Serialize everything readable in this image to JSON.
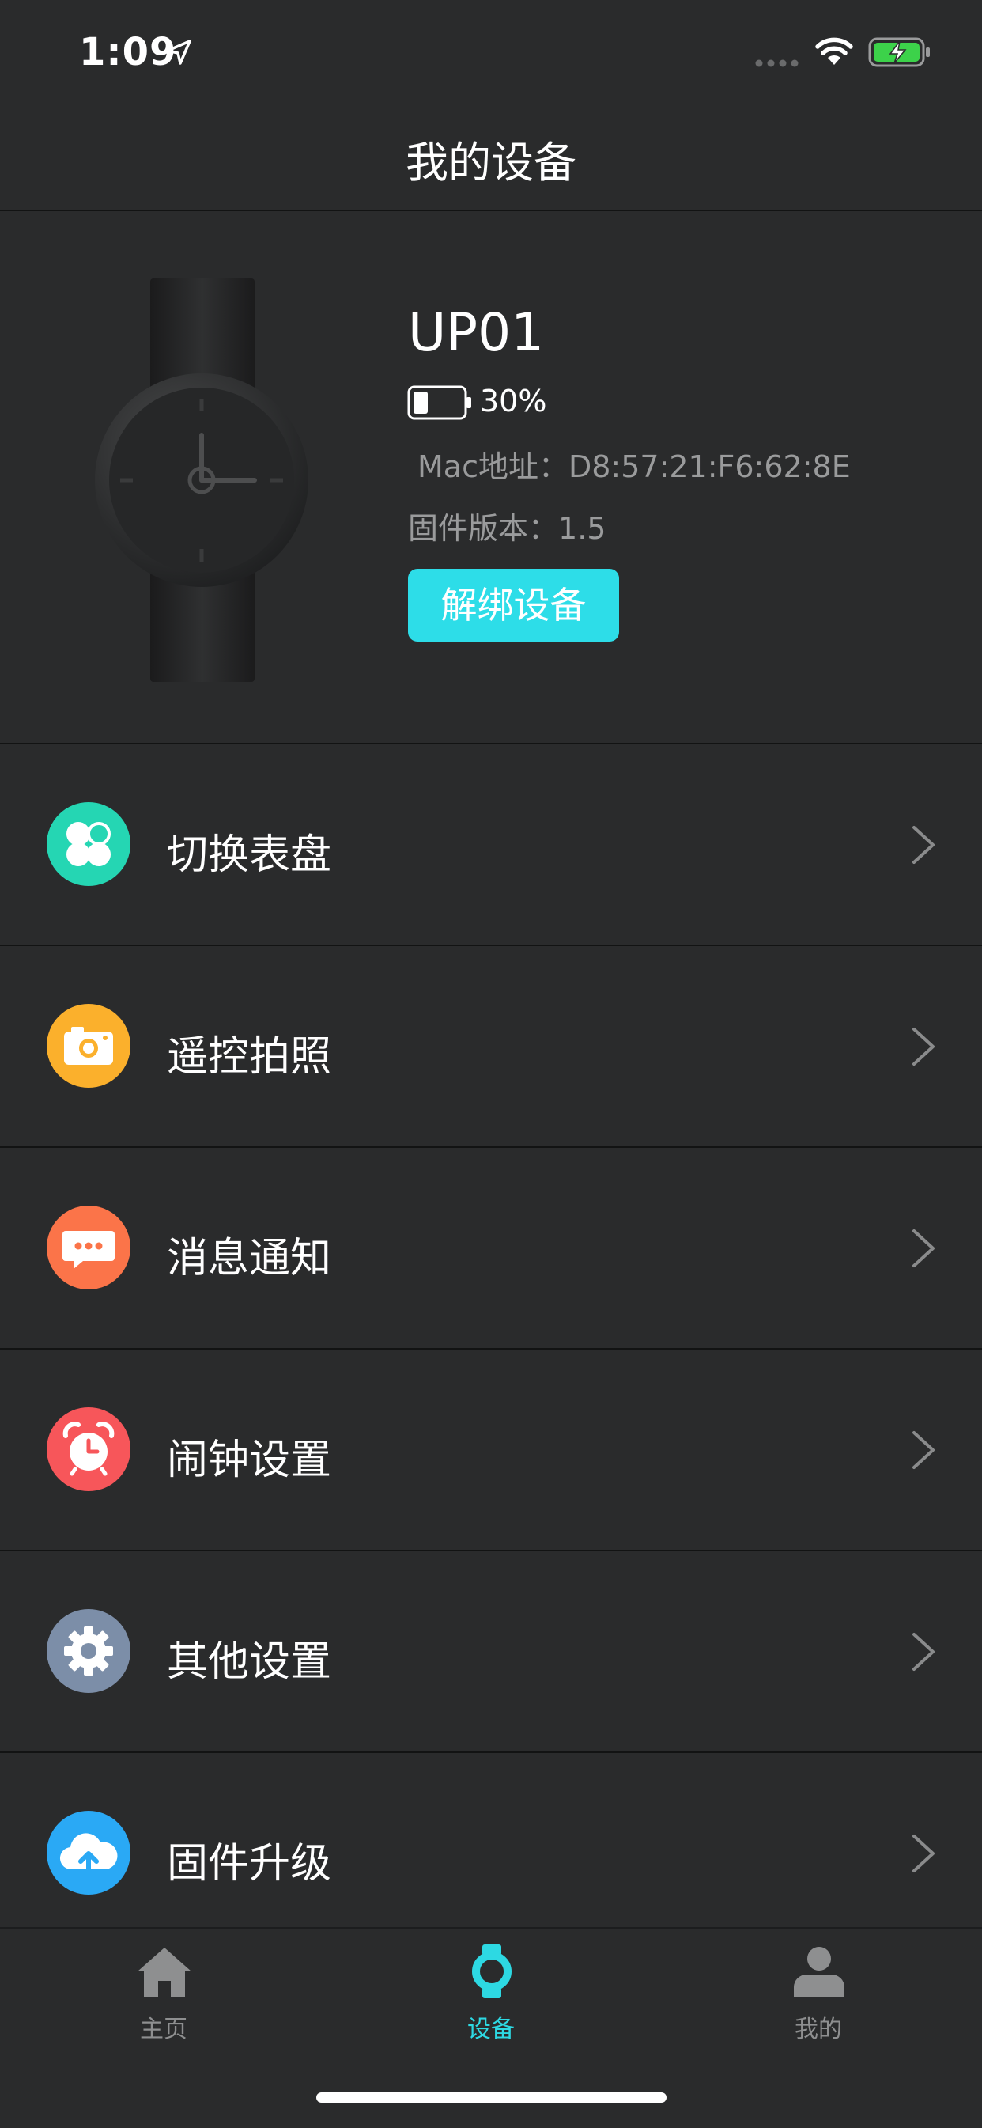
{
  "status_bar": {
    "time": "1:09",
    "icons": [
      "location-arrow-icon",
      "signal-icon",
      "wifi-icon",
      "battery-charging-icon"
    ],
    "battery_color": "#3cd24a"
  },
  "header": {
    "title": "我的设备"
  },
  "device": {
    "name": "UP01",
    "battery_percent": "30%",
    "battery_level": 0.3,
    "mac_label": "Mac地址：",
    "mac_value": "D8:57:21:F6:62:8E",
    "firmware_label": "固件版本：",
    "firmware_value": "1.5",
    "unbind_label": "解绑设备",
    "accent_color": "#2ddde8"
  },
  "menu": {
    "items": [
      {
        "label": "切换表盘",
        "icon": "watch-face-icon",
        "color": "#25d6b3"
      },
      {
        "label": "遥控拍照",
        "icon": "camera-icon",
        "color": "#fbb02c"
      },
      {
        "label": "消息通知",
        "icon": "message-icon",
        "color": "#fb7449"
      },
      {
        "label": "闹钟设置",
        "icon": "alarm-clock-icon",
        "color": "#f7565a"
      },
      {
        "label": "其他设置",
        "icon": "gear-icon",
        "color": "#7c8ea8"
      },
      {
        "label": "固件升级",
        "icon": "cloud-upload-icon",
        "color": "#2aa9f5"
      }
    ]
  },
  "tabs": {
    "items": [
      {
        "label": "主页",
        "icon": "home-icon",
        "active": false
      },
      {
        "label": "设备",
        "icon": "watch-icon",
        "active": true
      },
      {
        "label": "我的",
        "icon": "person-icon",
        "active": false
      }
    ],
    "active_color": "#2dd9e3",
    "inactive_color": "#8e8f90"
  }
}
